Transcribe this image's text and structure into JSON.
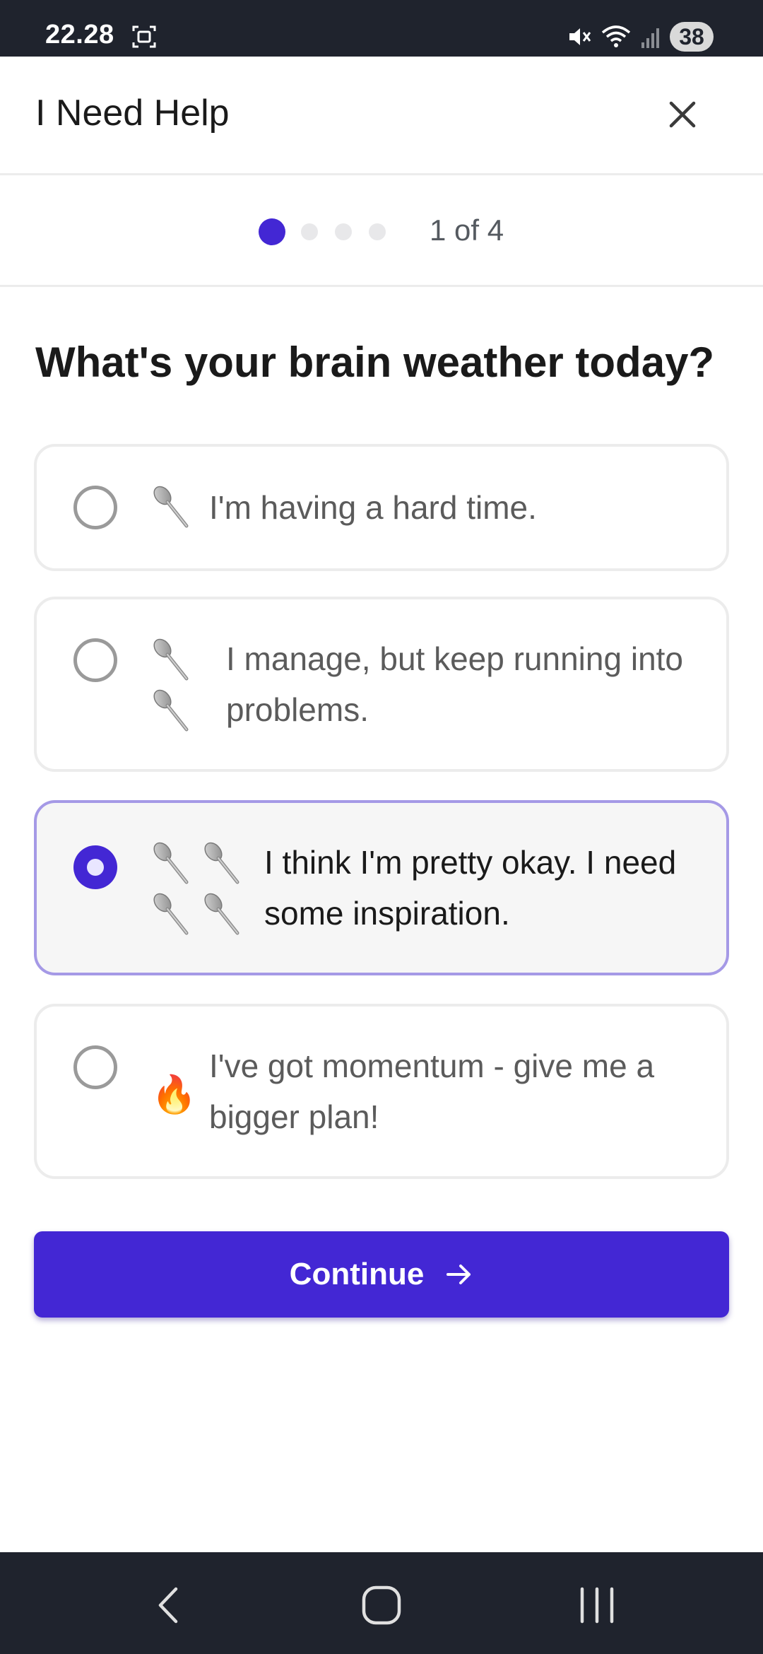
{
  "status_bar": {
    "time": "22.28",
    "battery": "38"
  },
  "header": {
    "title": "I Need Help"
  },
  "progress": {
    "current": 1,
    "total": 4,
    "label": "1 of 4"
  },
  "question": "What's your brain weather today?",
  "options": [
    {
      "label": "I'm having a hard time.",
      "icon": "spoon-icon",
      "icon_count": 1,
      "selected": false
    },
    {
      "label": "I manage, but keep running into problems.",
      "icon": "spoon-icon",
      "icon_count": 2,
      "selected": false
    },
    {
      "label": "I think I'm pretty okay. I need some inspiration.",
      "icon": "spoon-icon",
      "icon_count": 4,
      "selected": true
    },
    {
      "label": "I've got momentum - give me a bigger plan!",
      "icon": "fire-icon",
      "icon_count": 1,
      "selected": false
    }
  ],
  "continue_button": {
    "label": "Continue"
  },
  "colors": {
    "accent": "#4327d4",
    "selected_border": "#a599e6",
    "bar_background": "#1f232d"
  }
}
